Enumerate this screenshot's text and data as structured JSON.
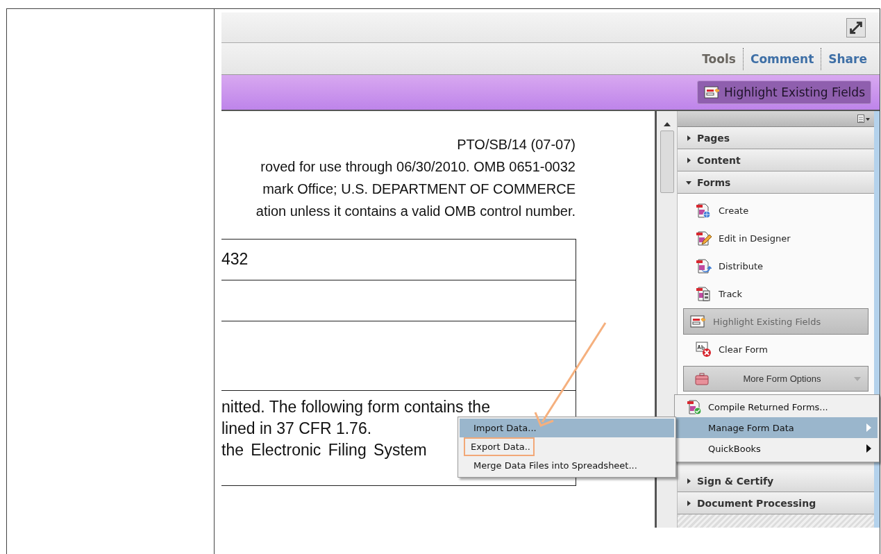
{
  "toolbar": {
    "tabs": [
      {
        "label": "Tools",
        "selected": true
      },
      {
        "label": "Comment",
        "selected": false
      },
      {
        "label": "Share",
        "selected": false
      }
    ]
  },
  "action_bar": {
    "button": "Highlight Existing Fields"
  },
  "document": {
    "header_lines": [
      "PTO/SB/14 (07-07)",
      "roved for use through 06/30/2010.  OMB 0651-0032",
      "mark Office; U.S. DEPARTMENT OF COMMERCE",
      "ation unless it contains a valid OMB control number."
    ],
    "form_rows": [
      {
        "lines": [
          "432"
        ]
      },
      {
        "lines": []
      },
      {
        "lines": []
      },
      {
        "lines": [
          "nitted. The following form contains the",
          "lined in 37 CFR 1.76.",
          "the Electronic Filing System"
        ]
      }
    ]
  },
  "panel": {
    "sections": [
      {
        "label": "Pages",
        "expanded": false
      },
      {
        "label": "Content",
        "expanded": false
      },
      {
        "label": "Forms",
        "expanded": true,
        "items": [
          {
            "kind": "tool",
            "label": "Create",
            "selected": false
          },
          {
            "kind": "tool",
            "label": "Edit in Designer",
            "selected": false
          },
          {
            "kind": "tool",
            "label": "Distribute",
            "selected": false
          },
          {
            "kind": "tool",
            "label": "Track",
            "selected": false
          },
          {
            "kind": "tool",
            "label": "Highlight Existing Fields",
            "selected": true
          },
          {
            "kind": "tool",
            "label": "Clear Form",
            "selected": false
          },
          {
            "kind": "dropdown",
            "label": "More Form Options",
            "selected": false
          }
        ]
      },
      {
        "label": "Sign & Certify",
        "expanded": false
      },
      {
        "label": "Document Processing",
        "expanded": false
      }
    ]
  },
  "submenu": {
    "items": [
      {
        "label": "Compile Returned Forms...",
        "selected": false,
        "has_submenu": false
      },
      {
        "label": "Manage Form Data",
        "selected": true,
        "has_submenu": true
      },
      {
        "label": "QuickBooks",
        "selected": false,
        "has_submenu": true
      }
    ]
  },
  "data_menu": {
    "items": [
      {
        "label": "Import Data...",
        "selected": true,
        "annotated": false
      },
      {
        "label": "Export Data..",
        "selected": false,
        "annotated": true
      },
      {
        "label": "Merge Data Files into Spreadsheet...",
        "selected": false,
        "annotated": false
      }
    ]
  },
  "annotation": {
    "kind": "arrow"
  }
}
